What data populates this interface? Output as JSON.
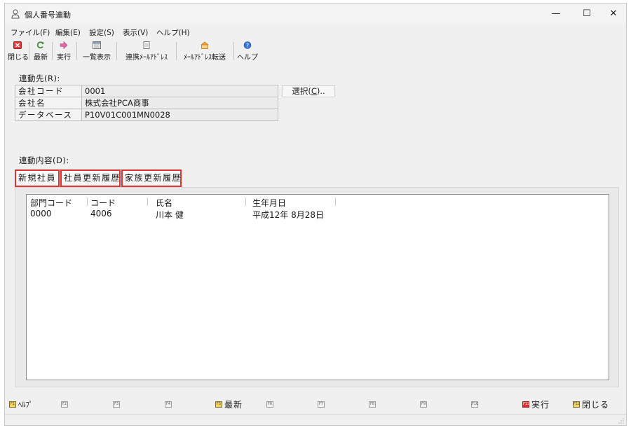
{
  "window": {
    "title": "個人番号連動",
    "controls": {
      "minimize": "—",
      "maximize": "☐",
      "close": "✕"
    }
  },
  "menu": [
    "ファイル(F)",
    "編集(E)",
    "設定(S)",
    "表示(V)",
    "ヘルプ(H)"
  ],
  "toolbar": [
    {
      "label": "閉じる",
      "icon": "close-icon"
    },
    {
      "label": "最新",
      "icon": "refresh-icon"
    },
    {
      "label": "実行",
      "icon": "arrow-right-icon"
    },
    {
      "label": "一覧表示",
      "icon": "list-view-icon"
    },
    {
      "label": "連携ﾒｰﾙｱﾄﾞﾚｽ",
      "icon": "address-book-icon"
    },
    {
      "label": "ﾒｰﾙｱﾄﾞﾚｽ転送",
      "icon": "mail-transfer-icon"
    },
    {
      "label": "ヘルプ",
      "icon": "help-icon"
    }
  ],
  "destination": {
    "section_label": "連動先(R):",
    "rows": [
      {
        "key": "会社コード",
        "value": "0001"
      },
      {
        "key": "会社名",
        "value": "株式会社PCA商事"
      },
      {
        "key": "データベース",
        "value": "P10V01C001MN0028"
      }
    ],
    "select_button": "選択(C)..",
    "select_button_parts": {
      "before": "選択(",
      "key": "C",
      "after": ").."
    }
  },
  "content": {
    "section_label": "連動内容(D):",
    "tabs": [
      "新規社員",
      "社員更新履歴",
      "家族更新履歴"
    ],
    "columns": [
      "部門コード",
      "コード",
      "氏名",
      "生年月日"
    ],
    "rows": [
      [
        "0000",
        "4006",
        "川本 健",
        "平成12年 8月28日"
      ]
    ]
  },
  "fkeys": [
    {
      "badge": "F1",
      "label": "ﾍﾙﾌﾟ",
      "style": "yellow"
    },
    {
      "badge": "F2",
      "label": ""
    },
    {
      "badge": "F3",
      "label": ""
    },
    {
      "badge": "F4",
      "label": ""
    },
    {
      "badge": "F5",
      "label": "最新",
      "style": "yellow"
    },
    {
      "badge": "F6",
      "label": ""
    },
    {
      "badge": "F7",
      "label": ""
    },
    {
      "badge": "F8",
      "label": ""
    },
    {
      "badge": "F9",
      "label": ""
    },
    {
      "badge": "F10",
      "label": ""
    },
    {
      "badge": "F11",
      "label": "実行",
      "style": "red"
    },
    {
      "badge": "F12",
      "label": "閉じる",
      "style": "yellow"
    }
  ],
  "colors": {
    "tab_highlight": "#e0322f",
    "background": "#f0f0f0"
  }
}
